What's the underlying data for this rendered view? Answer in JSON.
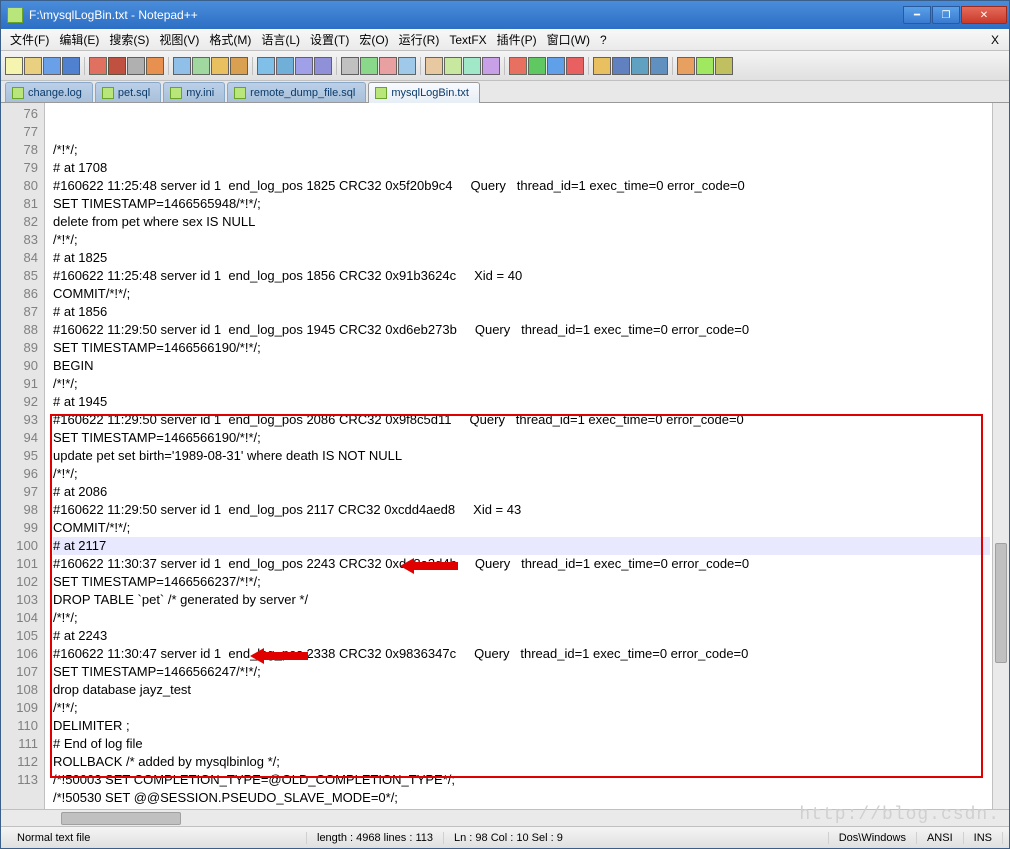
{
  "window": {
    "title": "F:\\mysqlLogBin.txt - Notepad++"
  },
  "menu": {
    "items": [
      "文件(F)",
      "编辑(E)",
      "搜索(S)",
      "视图(V)",
      "格式(M)",
      "语言(L)",
      "设置(T)",
      "宏(O)",
      "运行(R)",
      "TextFX",
      "插件(P)",
      "窗口(W)",
      "?"
    ]
  },
  "tabs": {
    "items": [
      "change.log",
      "pet.sql",
      "my.ini",
      "remote_dump_file.sql",
      "mysqlLogBin.txt"
    ],
    "active": 4
  },
  "editor": {
    "first_line_no": 76,
    "current_line_index": 22,
    "lines": [
      "/*!*/;",
      "# at 1708",
      "#160622 11:25:48 server id 1  end_log_pos 1825 CRC32 0x5f20b9c4     Query   thread_id=1 exec_time=0 error_code=0",
      "SET TIMESTAMP=1466565948/*!*/;",
      "delete from pet where sex IS NULL",
      "/*!*/;",
      "# at 1825",
      "#160622 11:25:48 server id 1  end_log_pos 1856 CRC32 0x91b3624c     Xid = 40",
      "COMMIT/*!*/;",
      "# at 1856",
      "#160622 11:29:50 server id 1  end_log_pos 1945 CRC32 0xd6eb273b     Query   thread_id=1 exec_time=0 error_code=0",
      "SET TIMESTAMP=1466566190/*!*/;",
      "BEGIN",
      "/*!*/;",
      "# at 1945",
      "#160622 11:29:50 server id 1  end_log_pos 2086 CRC32 0x9f8c5d11     Query   thread_id=1 exec_time=0 error_code=0",
      "SET TIMESTAMP=1466566190/*!*/;",
      "update pet set birth='1989-08-31' where death IS NOT NULL",
      "/*!*/;",
      "# at 2086",
      "#160622 11:29:50 server id 1  end_log_pos 2117 CRC32 0xcdd4aed8     Xid = 43",
      "COMMIT/*!*/;",
      "# at 2117",
      "#160622 11:30:37 server id 1  end_log_pos 2243 CRC32 0xde8a3d4b     Query   thread_id=1 exec_time=0 error_code=0",
      "SET TIMESTAMP=1466566237/*!*/;",
      "DROP TABLE `pet` /* generated by server */",
      "/*!*/;",
      "# at 2243",
      "#160622 11:30:47 server id 1  end_log_pos 2338 CRC32 0x9836347c     Query   thread_id=1 exec_time=0 error_code=0",
      "SET TIMESTAMP=1466566247/*!*/;",
      "drop database jayz_test",
      "/*!*/;",
      "DELIMITER ;",
      "# End of log file",
      "ROLLBACK /* added by mysqlbinlog */;",
      "/*!50003 SET COMPLETION_TYPE=@OLD_COMPLETION_TYPE*/;",
      "/*!50530 SET @@SESSION.PSEUDO_SLAVE_MODE=0*/;",
      ""
    ]
  },
  "status": {
    "file_type": "Normal text file",
    "length": "length : 4968    lines : 113",
    "position": "Ln : 98    Col : 10    Sel : 9",
    "eol": "Dos\\Windows",
    "encoding": "ANSI",
    "mode": "INS"
  },
  "toolbar_icons": [
    "new",
    "open",
    "save",
    "save-all",
    "close",
    "close-all",
    "print",
    "cut",
    "copy",
    "paste",
    "undo",
    "redo",
    "find",
    "replace",
    "zoom-in",
    "zoom-out",
    "sync",
    "wrap",
    "show-all",
    "indent",
    "func",
    "fold",
    "unfold",
    "hide",
    "record",
    "play",
    "play-multi",
    "stop",
    "macro",
    "tri-left",
    "tri-up",
    "tri-down",
    "bookmark",
    "spell",
    "eye"
  ],
  "watermark": "http://blog.csdn."
}
